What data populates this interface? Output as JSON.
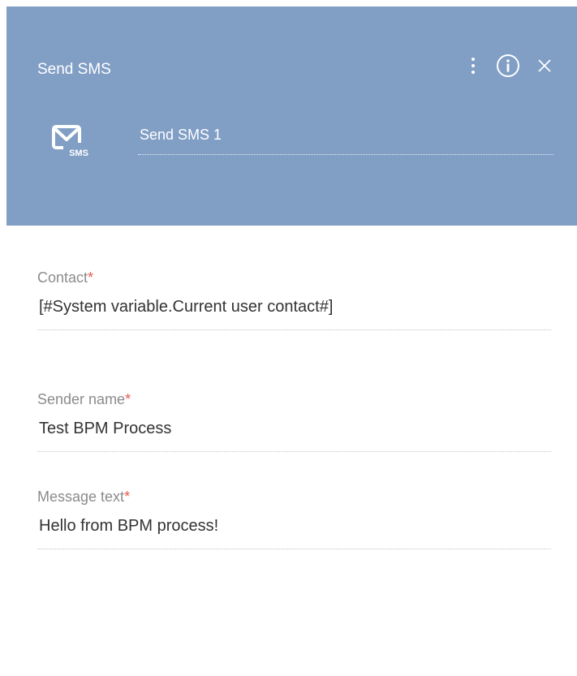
{
  "header": {
    "title": "Send SMS",
    "element_name": "Send SMS 1",
    "icon_caption": "SMS",
    "background_color": "#819ec5"
  },
  "fields": {
    "contact": {
      "label": "Contact",
      "required_mark": "*",
      "value": "[#System variable.Current user contact#]"
    },
    "sender_name": {
      "label": "Sender name",
      "required_mark": "*",
      "value": "Test BPM Process"
    },
    "message_text": {
      "label": "Message text",
      "required_mark": "*",
      "value": "Hello from BPM process!"
    }
  },
  "icons": [
    "kebab-menu-icon",
    "info-icon",
    "close-icon",
    "sms-envelope-icon"
  ],
  "colors": {
    "required": "#e9574f",
    "label": "#8b8b8b",
    "value": "#333333"
  }
}
